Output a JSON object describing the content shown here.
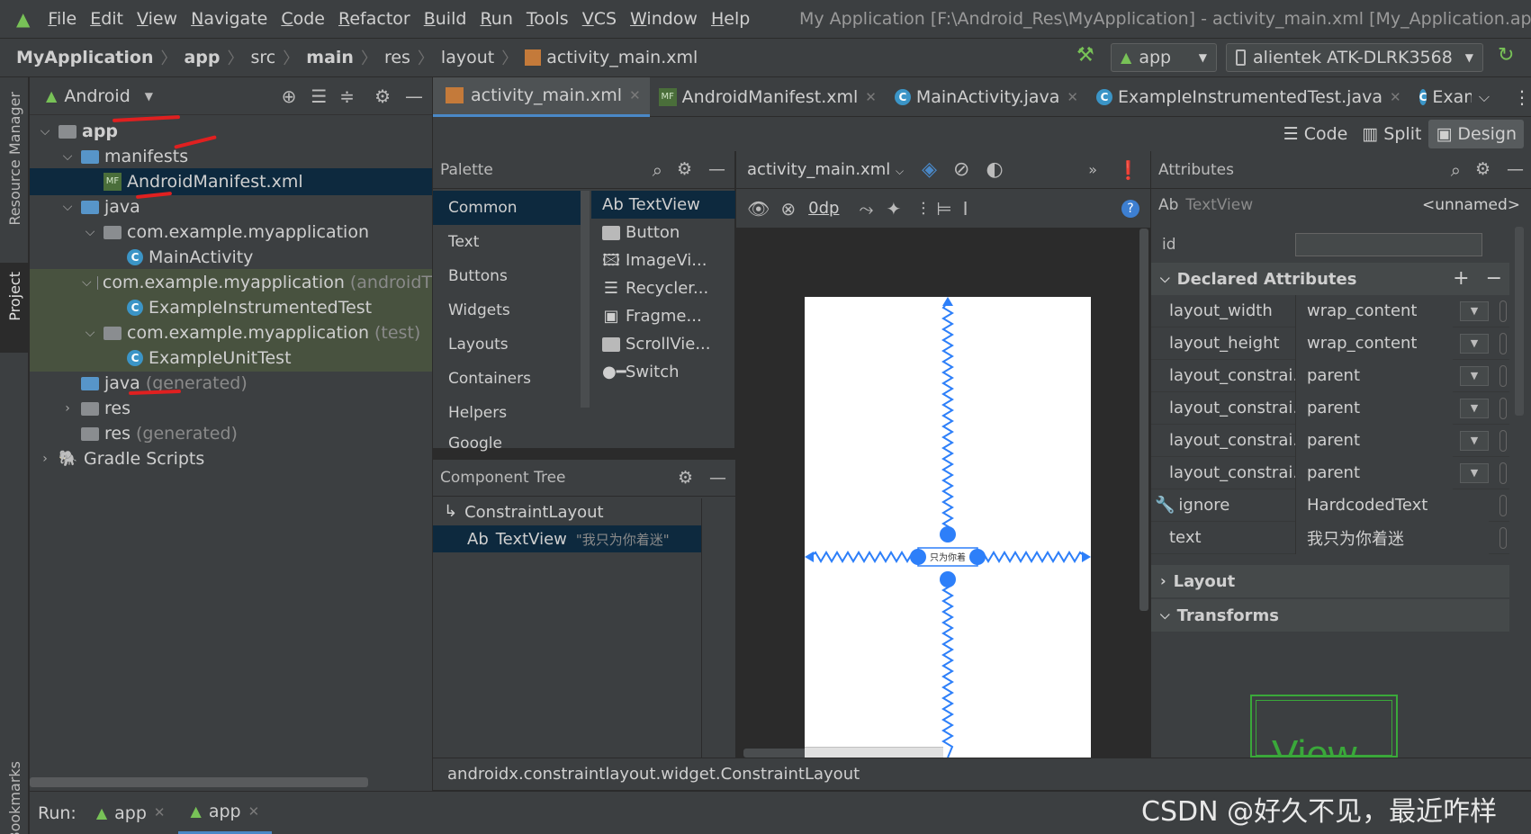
{
  "menu": {
    "items": [
      "File",
      "Edit",
      "View",
      "Navigate",
      "Code",
      "Refactor",
      "Build",
      "Run",
      "Tools",
      "VCS",
      "Window",
      "Help"
    ],
    "window_title": "My Application [F:\\Android_Res\\MyApplication] - activity_main.xml [My_Application.app.main"
  },
  "navbar": {
    "crumbs": [
      "MyApplication",
      "app",
      "src",
      "main",
      "res",
      "layout",
      "activity_main.xml"
    ],
    "run_config": "app",
    "device": "alientek ATK-DLRK3568"
  },
  "leftstrip": {
    "resource_manager": "Resource Manager",
    "project": "Project",
    "bookmarks": "Bookmarks"
  },
  "project": {
    "view_mode": "Android",
    "tree": [
      {
        "label": "app",
        "suffix": ""
      },
      {
        "label": "manifests",
        "suffix": ""
      },
      {
        "label": "AndroidManifest.xml",
        "suffix": ""
      },
      {
        "label": "java",
        "suffix": ""
      },
      {
        "label": "com.example.myapplication",
        "suffix": ""
      },
      {
        "label": "MainActivity",
        "suffix": ""
      },
      {
        "label": "com.example.myapplication",
        "suffix": "(androidT"
      },
      {
        "label": "ExampleInstrumentedTest",
        "suffix": ""
      },
      {
        "label": "com.example.myapplication",
        "suffix": "(test)"
      },
      {
        "label": "ExampleUnitTest",
        "suffix": ""
      },
      {
        "label": "java",
        "suffix": "(generated)"
      },
      {
        "label": "res",
        "suffix": ""
      },
      {
        "label": "res",
        "suffix": "(generated)"
      },
      {
        "label": "Gradle Scripts",
        "suffix": ""
      }
    ]
  },
  "tabs": [
    {
      "label": "activity_main.xml"
    },
    {
      "label": "AndroidManifest.xml"
    },
    {
      "label": "MainActivity.java"
    },
    {
      "label": "ExampleInstrumentedTest.java"
    },
    {
      "label": "Examp"
    }
  ],
  "modes": {
    "code": "Code",
    "split": "Split",
    "design": "Design"
  },
  "palette": {
    "title": "Palette",
    "categories": [
      "Common",
      "Text",
      "Buttons",
      "Widgets",
      "Layouts",
      "Containers",
      "Helpers",
      "Google"
    ],
    "items": [
      "TextView",
      "Button",
      "ImageVi...",
      "Recycler...",
      "Fragme...",
      "ScrollVie...",
      "Switch"
    ],
    "ab_prefix": "Ab"
  },
  "component_tree": {
    "title": "Component Tree",
    "root": "ConstraintLayout",
    "child_prefix": "Ab",
    "child": "TextView",
    "child_text": "\"我只为你着迷\""
  },
  "canvas": {
    "file": "activity_main.xml",
    "margin": "0dp",
    "preview_text": "只为你着"
  },
  "attributes": {
    "title": "Attributes",
    "widget_prefix": "Ab",
    "widget": "TextView",
    "widget_id": "<unnamed>",
    "id_label": "id",
    "declared_title": "Declared Attributes",
    "rows": [
      {
        "name": "layout_width",
        "value": "wrap_content"
      },
      {
        "name": "layout_height",
        "value": "wrap_content"
      },
      {
        "name": "layout_constrai...",
        "value": "parent"
      },
      {
        "name": "layout_constrai...",
        "value": "parent"
      },
      {
        "name": "layout_constrai...",
        "value": "parent"
      },
      {
        "name": "layout_constrai...",
        "value": "parent"
      },
      {
        "name": "ignore",
        "value": "HardcodedText"
      },
      {
        "name": "text",
        "value": "我只为你着迷"
      }
    ],
    "layout_section": "Layout",
    "transforms_section": "Transforms",
    "view_preview": "View"
  },
  "pathbar": {
    "text": "androidx.constraintlayout.widget.ConstraintLayout"
  },
  "runbar": {
    "label": "Run:",
    "tabs": [
      "app",
      "app"
    ]
  },
  "watermark": "CSDN @好久不见，最近咋样",
  "colors": {
    "accent": "#4a88c7",
    "selection": "#0d293e",
    "constraint": "#2d7ff9",
    "annotation": "#e02020",
    "android_green": "#78c257"
  }
}
